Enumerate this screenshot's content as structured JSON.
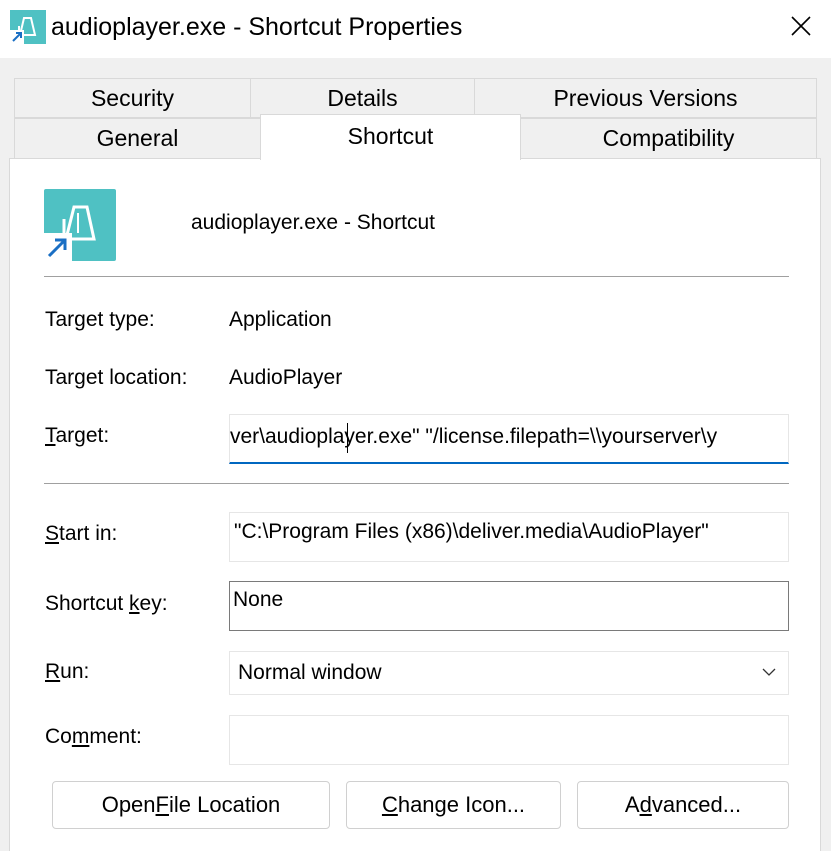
{
  "window": {
    "title": "audioplayer.exe - Shortcut Properties",
    "icon": "shortcut-app-icon",
    "close_icon": "close-icon"
  },
  "tabs": {
    "row1": [
      {
        "label": "Security"
      },
      {
        "label": "Details"
      },
      {
        "label": "Previous Versions"
      }
    ],
    "row2": [
      {
        "label": "General"
      },
      {
        "label": "Shortcut",
        "active": true
      },
      {
        "label": "Compatibility"
      }
    ]
  },
  "header": {
    "name": "audioplayer.exe - Shortcut"
  },
  "fields": {
    "target_type": {
      "label": "Target type:",
      "value": "Application"
    },
    "target_location": {
      "label": "Target location:",
      "value": "AudioPlayer"
    },
    "target": {
      "label_pre": "",
      "label_key": "T",
      "label_post": "arget:",
      "value": "ver\\audioplayer.exe\" \"/license.filepath=\\\\yourserver\\y"
    },
    "start_in": {
      "label_pre": "",
      "label_key": "S",
      "label_post": "tart in:",
      "value": "\"C:\\Program Files (x86)\\deliver.media\\AudioPlayer\""
    },
    "shortcut_key": {
      "label_pre": "Shortcut ",
      "label_key": "k",
      "label_post": "ey:",
      "value": "None"
    },
    "run": {
      "label_pre": "",
      "label_key": "R",
      "label_post": "un:",
      "value": "Normal window"
    },
    "comment": {
      "label_pre": "Co",
      "label_key": "m",
      "label_post": "ment:",
      "value": ""
    }
  },
  "buttons": {
    "open_file_location": {
      "pre": "Open ",
      "key": "F",
      "post": "ile Location"
    },
    "change_icon": {
      "pre": "",
      "key": "C",
      "post": "hange Icon..."
    },
    "advanced": {
      "pre": "A",
      "key": "d",
      "post": "vanced..."
    }
  },
  "colors": {
    "icon_teal": "#4fc1c3",
    "focus_blue": "#0067c0"
  }
}
